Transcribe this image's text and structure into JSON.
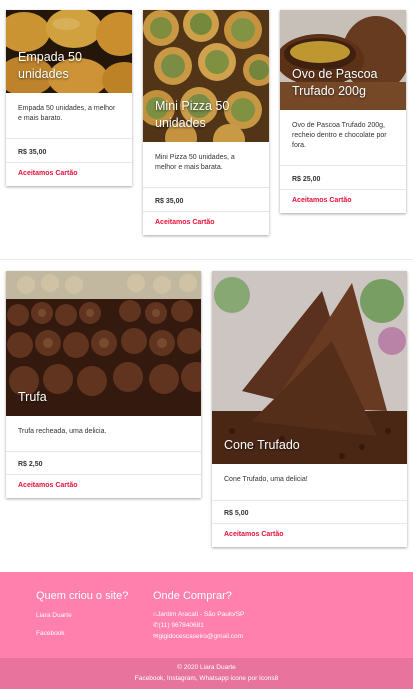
{
  "products": [
    {
      "title": "Empada 50 unidades",
      "description": "Empada 50 unidades, a melhor e mais barato.",
      "price": "R$ 35,00",
      "payment": "Aceitamos Cartão",
      "image": "empada-photo"
    },
    {
      "title": "Mini Pizza 50 unidades",
      "description": "Mini Pizza 50 unidades, a melhor e mais barata.",
      "price": "R$ 35,00",
      "payment": "Aceitamos Cartão",
      "image": "mini-pizza-photo"
    },
    {
      "title": "Ovo de Pascoa Trufado 200g",
      "description": "Ovo de Pascoa Trufado 200g, recheio dentro e chocolate por fora.",
      "price": "R$ 25,00",
      "payment": "Aceitamos Cartão",
      "image": "easter-egg-photo"
    },
    {
      "title": "Trufa",
      "description": "Trufa recheada, uma delicia.",
      "price": "R$ 2,50",
      "payment": "Aceitamos Cartão",
      "image": "truffles-photo"
    },
    {
      "title": "Cone Trufado",
      "description": "Cone Trufado, uma delicia!",
      "price": "R$ 5,00",
      "payment": "Aceitamos Cartão",
      "image": "cone-trufado-photo"
    }
  ],
  "footer": {
    "who_title": "Quem criou o site?",
    "author": "Liara Duarte",
    "facebook": "Facebook",
    "where_title": "Onde Comprar?",
    "address": "Jardim Aracati - São Paulo/SP",
    "phone": "(11) 967840681",
    "email": "gigidocescaseiro@gmail.com",
    "copyright": "© 2020 Liara Duarte",
    "credits": "Facebook, Instagram, Whatsapp icone por Icons8"
  },
  "colors": {
    "accent": "#e4113a",
    "footer": "#ff7fad",
    "footer_bottom": "#e8749e"
  }
}
